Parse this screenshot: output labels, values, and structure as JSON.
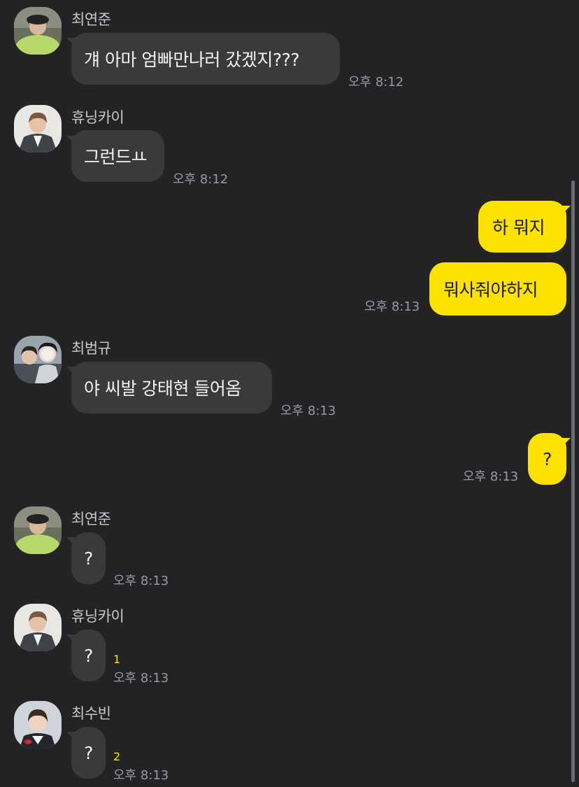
{
  "colors": {
    "background": "#232325",
    "incoming_bubble": "#3a3a3d",
    "outgoing_bubble": "#fde200",
    "unread_count": "#fde200",
    "timestamp": "#9a9a9e"
  },
  "icons": {
    "avatar_yeonjun": "profile-photo",
    "avatar_hueningkai": "profile-photo",
    "avatar_beomgyu": "profile-photo",
    "avatar_soobin": "profile-photo"
  },
  "messages": [
    {
      "sender": "최연준",
      "text": "걔 아마 엄빠만나러 갔겠지???",
      "time": "오후 8:12"
    },
    {
      "sender": "휴닝카이",
      "text": "그런드ㅛ",
      "time": "오후 8:12"
    },
    {
      "sender": "",
      "text": "하 뭐지",
      "time": ""
    },
    {
      "sender": "",
      "text": "뭐사줘야하지",
      "time": "오후 8:13"
    },
    {
      "sender": "최범규",
      "text": "야 씨발 강태현 들어옴",
      "time": "오후 8:13"
    },
    {
      "sender": "",
      "text": "?",
      "time": "오후 8:13"
    },
    {
      "sender": "최연준",
      "text": "?",
      "time": "오후 8:13"
    },
    {
      "sender": "휴닝카이",
      "text": "?",
      "time": "오후 8:13",
      "unread": "1"
    },
    {
      "sender": "최수빈",
      "text": "?",
      "time": "오후 8:13",
      "unread": "2"
    }
  ]
}
